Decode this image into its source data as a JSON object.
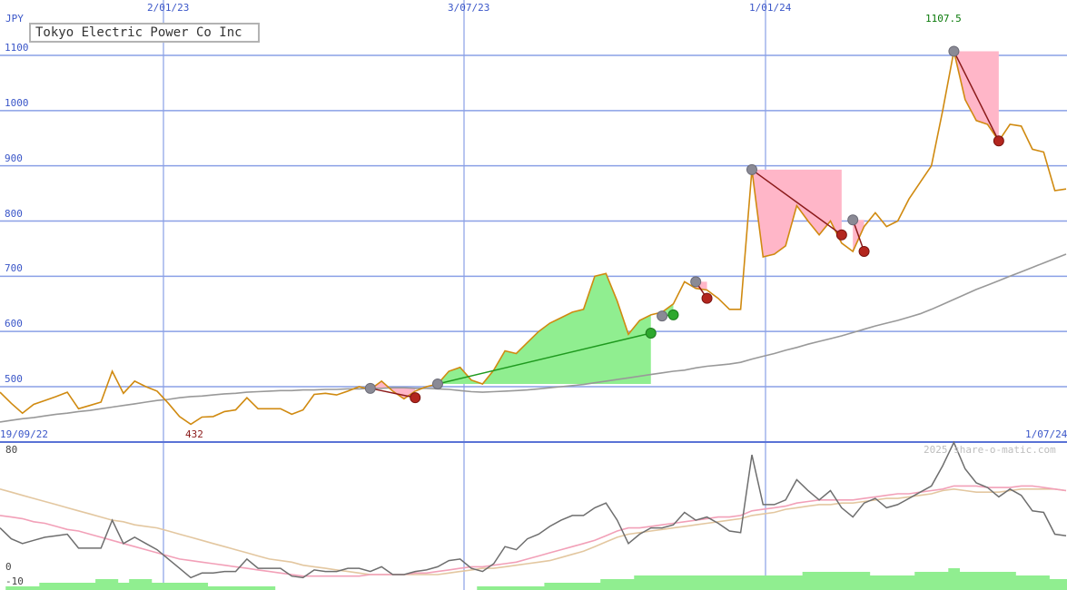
{
  "title": "Tokyo Electric Power Co Inc",
  "currency": "JPY",
  "watermark": "2025 share-o-matic.com",
  "date_start": "19/09/22",
  "date_end": "1/07/24",
  "max_label": "1107.5",
  "min_label": "432",
  "chart_data": [
    {
      "type": "line",
      "ylabel": "JPY",
      "ylim": [
        440,
        1130
      ],
      "xlim": [
        "19/09/22",
        "1/07/24"
      ],
      "x_tick_labels": [
        "2/01/23",
        "3/07/23",
        "1/01/24"
      ],
      "y_ticks": [
        500,
        600,
        700,
        800,
        900,
        1000,
        1100
      ],
      "grid": true,
      "series": [
        {
          "color": "#d08a10",
          "values": [
            490,
            470,
            452,
            468,
            475,
            482,
            490,
            460,
            466,
            472,
            528,
            488,
            510,
            500,
            492,
            470,
            446,
            432,
            445,
            446,
            455,
            458,
            480,
            460,
            460,
            460,
            450,
            458,
            486,
            488,
            485,
            492,
            500,
            495,
            510,
            492,
            478,
            492,
            500,
            505,
            528,
            535,
            512,
            505,
            530,
            565,
            560,
            580,
            600,
            615,
            625,
            635,
            640,
            700,
            705,
            655,
            595,
            620,
            630,
            635,
            650,
            690,
            678,
            675,
            660,
            640,
            640,
            893,
            735,
            740,
            755,
            828,
            800,
            775,
            800,
            760,
            745,
            790,
            815,
            790,
            800,
            840,
            870,
            900,
            1000,
            1107.5,
            1020,
            982,
            975,
            945,
            975,
            972,
            930,
            925,
            855,
            858
          ]
        },
        {
          "color": "#999999",
          "values": [
            436,
            439,
            442,
            444,
            447,
            450,
            452,
            455,
            457,
            460,
            463,
            466,
            469,
            472,
            475,
            477,
            480,
            482,
            483,
            485,
            487,
            488,
            490,
            491,
            492,
            493,
            493,
            494,
            494,
            495,
            495,
            496,
            496,
            497,
            497,
            498,
            498,
            497,
            497,
            496,
            495,
            493,
            491,
            490,
            491,
            492,
            493,
            494,
            496,
            498,
            500,
            502,
            504,
            507,
            510,
            513,
            516,
            519,
            522,
            525,
            528,
            530,
            534,
            537,
            539,
            541,
            544,
            550,
            555,
            560,
            566,
            571,
            577,
            582,
            587,
            592,
            598,
            604,
            610,
            615,
            620,
            626,
            632,
            640,
            649,
            658,
            667,
            676,
            684,
            692,
            700,
            708,
            716,
            724,
            732,
            740
          ]
        }
      ],
      "signals": [
        {
          "type": "sell",
          "from": [
            33,
            497
          ],
          "to": [
            37,
            480
          ]
        },
        {
          "type": "buy",
          "from": [
            39,
            505
          ],
          "to": [
            58,
            597
          ]
        },
        {
          "type": "buy",
          "from": [
            59,
            628
          ],
          "to": [
            60,
            630
          ]
        },
        {
          "type": "sell",
          "from": [
            62,
            690
          ],
          "to": [
            63,
            660
          ]
        },
        {
          "type": "sell",
          "from": [
            67,
            893
          ],
          "to": [
            75,
            775
          ]
        },
        {
          "type": "sell",
          "from": [
            76,
            802
          ],
          "to": [
            77,
            745
          ]
        },
        {
          "type": "sell",
          "from": [
            85,
            1107.5
          ],
          "to": [
            89,
            945
          ]
        }
      ]
    },
    {
      "type": "line",
      "ylim": [
        -10,
        80
      ],
      "y_ticks": [
        80,
        0,
        -10
      ],
      "series": [
        {
          "color": "#6e6e6e",
          "values": [
            30,
            23,
            20,
            22,
            24,
            25,
            26,
            17,
            17,
            17,
            35,
            20,
            24,
            20,
            16,
            10,
            4,
            -2,
            1,
            1,
            2,
            2,
            10,
            4,
            4,
            4,
            -1,
            -2,
            3,
            2,
            2,
            4,
            4,
            2,
            5,
            0,
            0,
            2,
            3,
            5,
            9,
            10,
            4,
            2,
            7,
            18,
            16,
            23,
            26,
            31,
            35,
            38,
            38,
            43,
            46,
            35,
            20,
            26,
            30,
            30,
            32,
            40,
            35,
            37,
            33,
            28,
            27,
            77,
            45,
            45,
            48,
            61,
            54,
            48,
            54,
            43,
            37,
            46,
            49,
            43,
            45,
            49,
            53,
            57,
            70,
            85,
            68,
            59,
            56,
            50,
            55,
            51,
            41,
            40,
            26,
            25
          ]
        },
        {
          "color": "#f2a0b8",
          "values": [
            38,
            37,
            36,
            34,
            33,
            31,
            29,
            28,
            26,
            24,
            22,
            20,
            18,
            16,
            14,
            12,
            10,
            9,
            8,
            7,
            6,
            5,
            4,
            3,
            2,
            1,
            0,
            -1,
            -1,
            -1,
            -1,
            -1,
            -1,
            0,
            0,
            0,
            0,
            1,
            1,
            2,
            3,
            4,
            5,
            5,
            6,
            7,
            8,
            10,
            12,
            14,
            16,
            18,
            20,
            22,
            25,
            28,
            30,
            30,
            31,
            32,
            33,
            34,
            35,
            36,
            37,
            37,
            38,
            41,
            42,
            43,
            44,
            46,
            47,
            48,
            48,
            48,
            48,
            49,
            50,
            51,
            52,
            52,
            53,
            54,
            55,
            57,
            57,
            57,
            56,
            56,
            56,
            57,
            57,
            56,
            55,
            54
          ]
        },
        {
          "color": "#e3c7a0",
          "values": [
            55,
            53,
            51,
            49,
            47,
            45,
            43,
            41,
            39,
            37,
            35,
            34,
            32,
            31,
            30,
            28,
            26,
            24,
            22,
            20,
            18,
            16,
            14,
            12,
            10,
            9,
            8,
            6,
            5,
            4,
            3,
            2,
            1,
            0,
            0,
            0,
            0,
            0,
            0,
            0,
            1,
            2,
            3,
            4,
            4,
            5,
            6,
            7,
            8,
            9,
            11,
            13,
            15,
            18,
            21,
            24,
            26,
            27,
            28,
            29,
            30,
            31,
            32,
            33,
            34,
            35,
            36,
            38,
            39,
            40,
            42,
            43,
            44,
            45,
            45,
            46,
            46,
            47,
            48,
            49,
            49,
            50,
            51,
            52,
            54,
            55,
            54,
            53,
            53,
            53,
            54,
            55,
            55,
            55,
            55,
            54
          ]
        }
      ],
      "bars": {
        "color": "#90ee90",
        "values": [
          0,
          1,
          1,
          1,
          2,
          2,
          2,
          2,
          2,
          3,
          3,
          2,
          3,
          3,
          2,
          2,
          2,
          2,
          2,
          1,
          1,
          1,
          1,
          1,
          1,
          0,
          0,
          0,
          0,
          0,
          0,
          0,
          0,
          0,
          0,
          0,
          0,
          0,
          0,
          0,
          0,
          0,
          0,
          1,
          1,
          1,
          1,
          1,
          1,
          2,
          2,
          2,
          2,
          2,
          3,
          3,
          3,
          4,
          4,
          4,
          4,
          4,
          4,
          4,
          4,
          4,
          4,
          4,
          4,
          4,
          4,
          4,
          5,
          5,
          5,
          5,
          5,
          5,
          4,
          4,
          4,
          4,
          5,
          5,
          5,
          6,
          5,
          5,
          5,
          5,
          5,
          4,
          4,
          4,
          3,
          3
        ]
      }
    }
  ]
}
